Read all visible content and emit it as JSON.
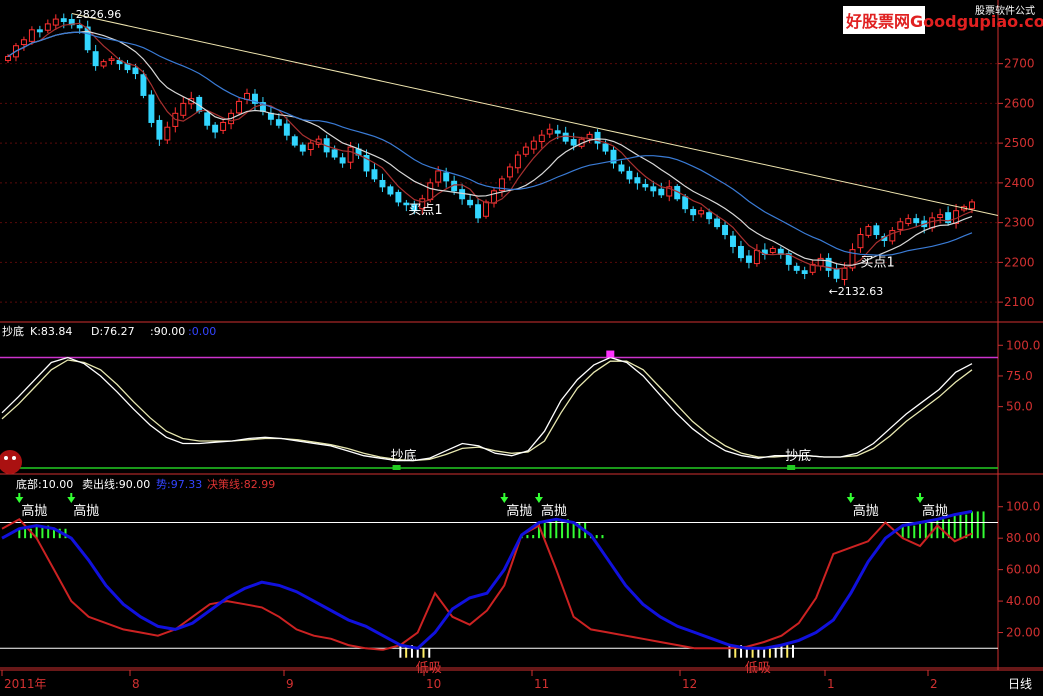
{
  "watermark": {
    "brand": "好股票网Goodgupiao.com",
    "sub": "股票软件公式"
  },
  "colors": {
    "up": "#ff3030",
    "down": "#33d6ff",
    "ma1": "#a83030",
    "ma2": "#d8d8d8",
    "ma3": "#3a7bd5",
    "trend": "#f0e6b0",
    "grid": "#5a0a0a",
    "axis": "#d03030",
    "magenta": "#cc33cc",
    "green": "#22cc22",
    "kline": "#ffffff",
    "dline": "#e8e8b0",
    "blue": "#1111dd",
    "red": "#cc2222",
    "hiBar": "#33ff33"
  },
  "chart_data": [
    {
      "type": "candlestick",
      "title": "",
      "ylim": [
        2050,
        2850
      ],
      "yticks": [
        "2700",
        "2600",
        "2500",
        "2400",
        "2300",
        "2200",
        "2100"
      ],
      "annotations": {
        "high": "2826.96",
        "low": "←2132.63",
        "buy_label": "买点1"
      },
      "closes": [
        2718,
        2745,
        2760,
        2785,
        2780,
        2800,
        2812,
        2806,
        2798,
        2790,
        2735,
        2695,
        2705,
        2712,
        2700,
        2685,
        2675,
        2620,
        2552,
        2510,
        2540,
        2575,
        2600,
        2612,
        2580,
        2545,
        2528,
        2552,
        2575,
        2605,
        2625,
        2600,
        2580,
        2560,
        2545,
        2520,
        2495,
        2480,
        2500,
        2510,
        2478,
        2465,
        2450,
        2490,
        2470,
        2430,
        2410,
        2390,
        2372,
        2352,
        2345,
        2330,
        2360,
        2400,
        2430,
        2405,
        2380,
        2360,
        2345,
        2312,
        2352,
        2380,
        2410,
        2440,
        2470,
        2490,
        2505,
        2520,
        2535,
        2525,
        2505,
        2495,
        2510,
        2522,
        2500,
        2480,
        2450,
        2430,
        2410,
        2400,
        2390,
        2380,
        2370,
        2390,
        2360,
        2335,
        2320,
        2330,
        2310,
        2290,
        2270,
        2240,
        2212,
        2200,
        2230,
        2220,
        2235,
        2220,
        2195,
        2180,
        2172,
        2195,
        2210,
        2180,
        2160,
        2185,
        2232,
        2270,
        2290,
        2270,
        2255,
        2280,
        2302,
        2310,
        2300,
        2290,
        2312,
        2320,
        2300,
        2330,
        2340,
        2352
      ],
      "ma_note": "three moving averages drawn from closes"
    },
    {
      "type": "line",
      "name": "抄底",
      "ylim": [
        0,
        110
      ],
      "yticks": [
        "100.0",
        "75.0",
        "50.0"
      ],
      "header": {
        "title": "抄底",
        "k": "K:83.84",
        "d": "D:76.27",
        "level": ":90.00",
        "level2": ":0.00"
      },
      "K": [
        45,
        58,
        72,
        86,
        90,
        85,
        75,
        62,
        48,
        35,
        25,
        20,
        20,
        21,
        22,
        24,
        25,
        24,
        22,
        20,
        18,
        14,
        10,
        8,
        6,
        6,
        8,
        14,
        20,
        18,
        12,
        10,
        14,
        30,
        55,
        72,
        84,
        90,
        86,
        75,
        60,
        45,
        32,
        22,
        14,
        10,
        8,
        10,
        10,
        10,
        9,
        9,
        12,
        20,
        32,
        44,
        54,
        64,
        78,
        85
      ],
      "D": [
        40,
        52,
        66,
        80,
        88,
        86,
        80,
        68,
        54,
        41,
        30,
        24,
        22,
        22,
        22,
        23,
        24,
        24,
        23,
        21,
        19,
        16,
        12,
        9,
        7,
        6,
        7,
        11,
        16,
        17,
        14,
        12,
        13,
        22,
        45,
        65,
        78,
        87,
        87,
        80,
        66,
        52,
        38,
        27,
        18,
        12,
        9,
        9,
        10,
        10,
        9,
        9,
        10,
        16,
        26,
        38,
        48,
        58,
        70,
        80
      ],
      "labels": [
        "抄底",
        "抄底"
      ],
      "signals_at": [
        24,
        48
      ],
      "marker_at": 37,
      "bands": [
        90,
        0
      ]
    },
    {
      "type": "line",
      "name": "决策线",
      "ylim": [
        0,
        110
      ],
      "yticks": [
        "100.0",
        "80.00",
        "60.00",
        "40.00",
        "20.00"
      ],
      "header": {
        "base": "底部:10.00",
        "sell": "卖出线:90.00",
        "trend": "势:97.33",
        "decide": "决策线:82.99"
      },
      "trend": [
        80,
        86,
        88,
        86,
        80,
        66,
        50,
        38,
        30,
        24,
        22,
        26,
        34,
        42,
        48,
        52,
        50,
        46,
        40,
        34,
        28,
        24,
        18,
        12,
        10,
        20,
        35,
        42,
        45,
        60,
        82,
        90,
        92,
        90,
        82,
        66,
        50,
        38,
        30,
        24,
        20,
        16,
        12,
        10,
        10,
        12,
        15,
        20,
        28,
        45,
        65,
        80,
        88,
        90,
        92,
        95,
        97
      ],
      "decide": [
        86,
        92,
        80,
        60,
        40,
        30,
        26,
        22,
        20,
        18,
        22,
        30,
        38,
        40,
        38,
        36,
        30,
        22,
        18,
        16,
        12,
        10,
        9,
        12,
        20,
        45,
        30,
        25,
        34,
        50,
        82,
        88,
        60,
        30,
        22,
        20,
        18,
        16,
        14,
        12,
        10,
        10,
        10,
        11,
        14,
        18,
        26,
        42,
        70,
        74,
        78,
        90,
        80,
        75,
        88,
        78,
        83
      ],
      "labels": {
        "high": "高抛",
        "low": "低吸"
      },
      "high_at": [
        1,
        4,
        29,
        31,
        49,
        53
      ],
      "low_at": [
        24,
        43
      ],
      "bands": [
        90,
        10
      ]
    }
  ],
  "xaxis": {
    "labels": [
      "2011年",
      "8",
      "9",
      "10",
      "11",
      "12",
      "1",
      "2"
    ],
    "period": "日线"
  }
}
